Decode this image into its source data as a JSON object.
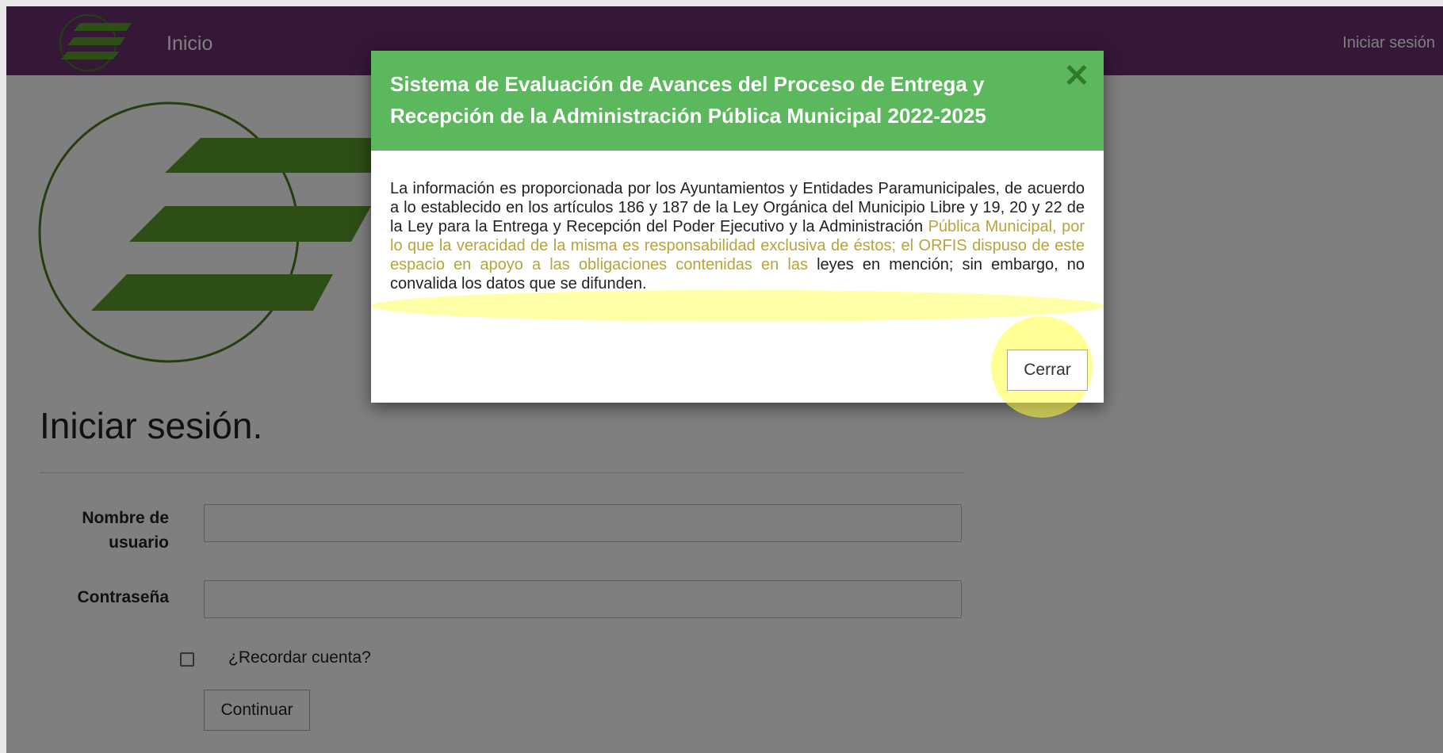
{
  "navbar": {
    "home_label": "Inicio",
    "login_label": "Iniciar sesión",
    "background": "#6b2f6f",
    "logo_icon": "orfis-logo-icon"
  },
  "page": {
    "title": "Iniciar sesión.",
    "username_label": "Nombre de usuario",
    "username_value": "",
    "password_label": "Contraseña",
    "password_value": "",
    "remember_label": "¿Recordar cuenta?",
    "remember_checked": false,
    "continue_label": "Continuar"
  },
  "modal": {
    "title": "Sistema de Evaluación de Avances del Proceso de Entrega y Recepción de la Administración Pública Municipal 2022-2025",
    "body_part1": "La información es proporcionada por los Ayuntamientos y Entidades Paramunicipales, de acuerdo a lo establecido en los artículos 186 y 187 de la Ley Orgánica del Municipio Libre y 19, 20 y 22 de la Ley para la Entrega y Recepción del Poder Ejecutivo y la Administración ",
    "body_highlight": "Pública Municipal, por lo que la veracidad de la misma es responsabilidad exclusiva de éstos; el ORFIS dispuso de este espacio en apoyo a las obligaciones contenidas en las",
    "body_part2": " leyes en mención; sin embargo, no convalida los datos que se difunden.",
    "close_label": "Cerrar",
    "close_icon": "close-icon",
    "header_color": "#5cb85c"
  }
}
